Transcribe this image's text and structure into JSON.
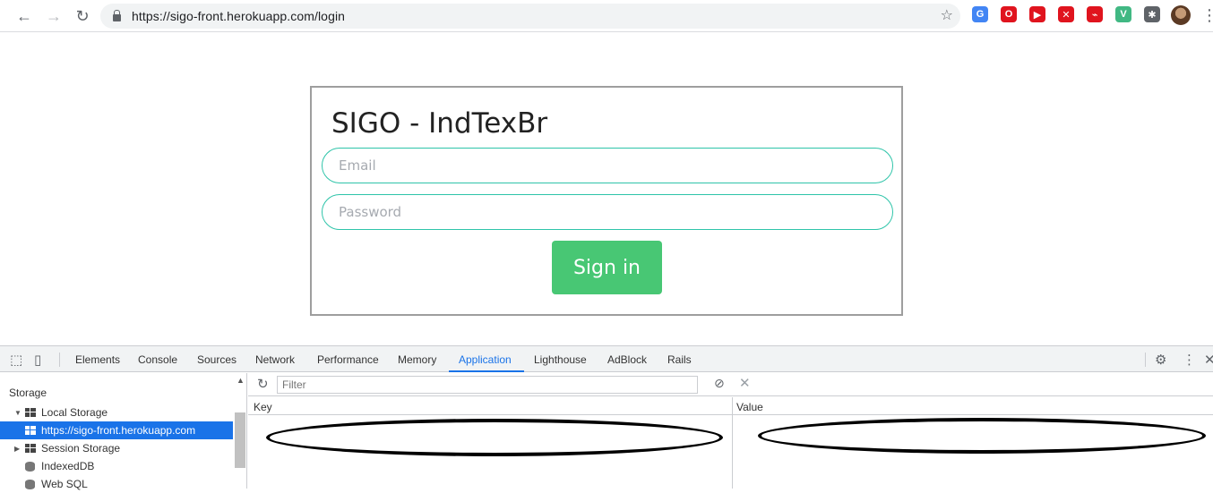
{
  "browser": {
    "url_scheme": "https://",
    "url_host": "sigo-front.herokuapp.com",
    "url_path": "/login",
    "extensions": [
      {
        "name": "google-translate-icon",
        "color": "#4285f4",
        "glyph": "G"
      },
      {
        "name": "opera-icon",
        "color": "#e0141e",
        "glyph": "O"
      },
      {
        "name": "youtube-icon",
        "color": "#e0141e",
        "glyph": "▶"
      },
      {
        "name": "adblock-icon",
        "color": "#e0141e",
        "glyph": "✕"
      },
      {
        "name": "feed-icon",
        "color": "#e0141e",
        "glyph": "⌁"
      },
      {
        "name": "vue-devtools-icon",
        "color": "#41b883",
        "glyph": "V"
      },
      {
        "name": "puzzle-extensions-icon",
        "color": "#5f6368",
        "glyph": "✱"
      }
    ]
  },
  "login": {
    "title": "SIGO - IndTexBr",
    "email_placeholder": "Email",
    "password_placeholder": "Password",
    "signin_label": "Sign in"
  },
  "devtools": {
    "tabs": [
      "Elements",
      "Console",
      "Sources",
      "Network",
      "Performance",
      "Memory",
      "Application",
      "Lighthouse",
      "AdBlock",
      "Rails"
    ],
    "active_tab": "Application",
    "sidebar": {
      "heading": "Storage",
      "local_storage": "Local Storage",
      "local_storage_origin": "https://sigo-front.herokuapp.com",
      "session_storage": "Session Storage",
      "indexeddb": "IndexedDB",
      "websql": "Web SQL"
    },
    "filter_placeholder": "Filter",
    "table": {
      "key_header": "Key",
      "value_header": "Value"
    }
  }
}
